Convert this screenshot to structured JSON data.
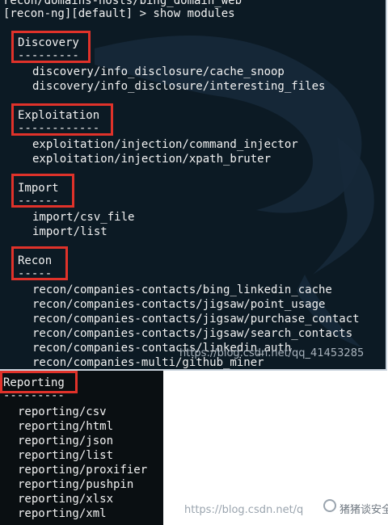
{
  "terminal": {
    "cut_line": "recon/domains-hosts/bing_domain_web",
    "prompt_line": "[recon-ng][default] > show modules",
    "sections": [
      {
        "name": "Discovery",
        "rule": "---------",
        "modules": [
          "discovery/info_disclosure/cache_snoop",
          "discovery/info_disclosure/interesting_files"
        ]
      },
      {
        "name": "Exploitation",
        "rule": "------------",
        "modules": [
          "exploitation/injection/command_injector",
          "exploitation/injection/xpath_bruter"
        ]
      },
      {
        "name": "Import",
        "rule": "------",
        "modules": [
          "import/csv_file",
          "import/list"
        ]
      },
      {
        "name": "Recon",
        "rule": "-----",
        "modules": [
          "recon/companies-contacts/bing_linkedin_cache",
          "recon/companies-contacts/jigsaw/point_usage",
          "recon/companies-contacts/jigsaw/purchase_contact",
          "recon/companies-contacts/jigsaw/search_contacts",
          "recon/companies-contacts/linkedin_auth",
          "recon/companies-multi/github_miner"
        ]
      }
    ],
    "reporting": {
      "name": "Reporting",
      "rule": "---------",
      "modules": [
        "reporting/csv",
        "reporting/html",
        "reporting/json",
        "reporting/list",
        "reporting/proxifier",
        "reporting/pushpin",
        "reporting/xlsx",
        "reporting/xml"
      ]
    }
  },
  "watermarks": {
    "top": "https://blog.csdn.net/qq_41453285",
    "bottom": "https://blog.csdn.net/q",
    "wechat": "猪猪谈安全"
  },
  "colors": {
    "terminal_bg": "#0c1a24",
    "text": "#f2f2f2",
    "highlight": "#e0322a"
  }
}
